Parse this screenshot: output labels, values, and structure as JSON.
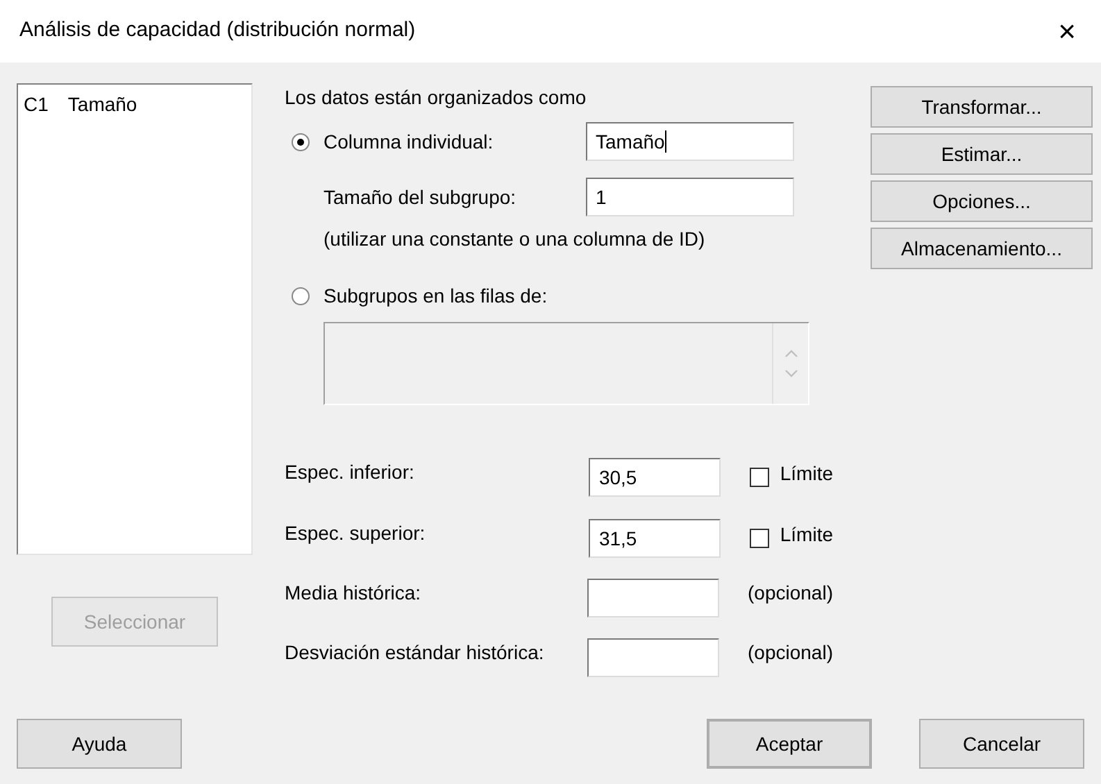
{
  "window": {
    "title": "Análisis de capacidad (distribución normal)",
    "close": "×"
  },
  "variables_list": {
    "items": [
      {
        "column": "C1",
        "name": "Tamaño"
      }
    ]
  },
  "select_button": {
    "label": "Seleccionar",
    "disabled": true
  },
  "data_arrangement": {
    "label": "Los datos están organizados como",
    "options": [
      {
        "kind": "single",
        "label": "Columna individual:",
        "selected": true,
        "value": "Tamaño",
        "subgroup_label": "Tamaño del subgrupo:",
        "subgroup_value": "1",
        "hint": "(utilizar una constante o una columna de ID)"
      },
      {
        "kind": "rows",
        "label": "Subgrupos en las filas de:",
        "selected": false
      }
    ]
  },
  "specs": [
    {
      "kind": "check",
      "label": "Espec. inferior:",
      "value": "30,5",
      "checkbox": {
        "label": "Límite",
        "checked": false
      }
    },
    {
      "kind": "check",
      "label": "Espec. superior:",
      "value": "31,5",
      "checkbox": {
        "label": "Límite",
        "checked": false
      }
    },
    {
      "kind": "note",
      "label": "Media histórica:",
      "note": "(opcional)"
    },
    {
      "kind": "note",
      "label": "Desviación estándar histórica:",
      "note": "(opcional)"
    }
  ],
  "side_buttons": [
    "Transformar...",
    "Estimar...",
    "Opciones...",
    "Almacenamiento..."
  ],
  "footer": {
    "help": "Ayuda",
    "ok": "Aceptar",
    "cancel": "Cancelar"
  }
}
